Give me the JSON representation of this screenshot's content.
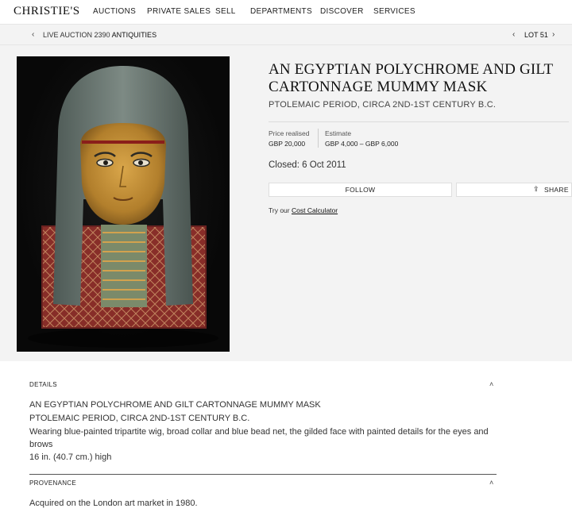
{
  "brand": {
    "logo": "CHRISTIE'S"
  },
  "nav": [
    "AUCTIONS",
    "PRIVATE SALES",
    "SELL",
    "DEPARTMENTS",
    "DISCOVER",
    "SERVICES"
  ],
  "breadcrumb": {
    "sale": "LIVE AUCTION 2390",
    "department": "ANTIQUITIES"
  },
  "lot": {
    "label": "LOT 51",
    "title": "AN EGYPTIAN POLYCHROME AND GILT CARTONNAGE MUMMY MASK",
    "subtitle": "PTOLEMAIC PERIOD, CIRCA 2ND-1ST CENTURY B.C.",
    "price_realised_label": "Price realised",
    "price_realised": "GBP 20,000",
    "estimate_label": "Estimate",
    "estimate": "GBP 4,000 – GBP 6,000",
    "closed": "Closed: 6 Oct 2011"
  },
  "actions": {
    "follow": "FOLLOW",
    "share": "SHARE",
    "calc_prefix": "Try our",
    "calc_link": "Cost Calculator"
  },
  "details": {
    "heading": "DETAILS",
    "lines": [
      "AN EGYPTIAN POLYCHROME AND GILT CARTONNAGE MUMMY MASK",
      "PTOLEMAIC PERIOD, CIRCA 2ND-1ST CENTURY B.C.",
      "Wearing blue-painted tripartite wig, broad collar and blue bead net, the gilded face with painted details for the eyes and",
      "brows",
      "16 in. (40.7 cm.) high"
    ]
  },
  "provenance": {
    "heading": "PROVENANCE",
    "text": "Acquired on the London art market in 1980."
  },
  "icons": {
    "back": "chevron-left-icon",
    "prev": "chevron-left-icon",
    "next": "chevron-right-icon",
    "collapse": "chevron-up-icon",
    "share": "share-icon"
  },
  "colors": {
    "page_bg": "#ffffff",
    "panel_bg": "#f3f3f3",
    "text": "#222222"
  }
}
